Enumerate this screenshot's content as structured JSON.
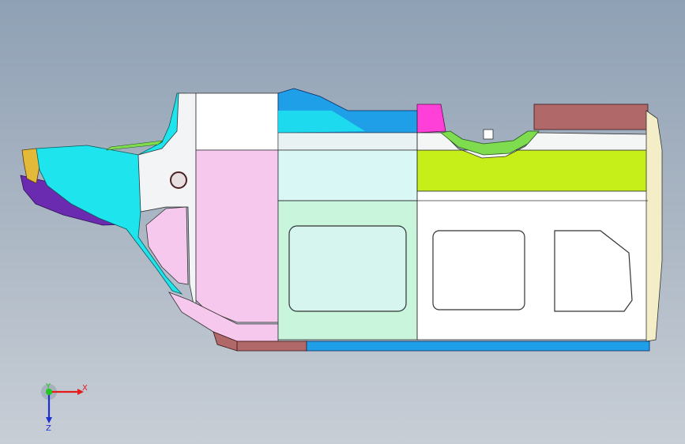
{
  "viewport": {
    "background_top": "#8fa1b5",
    "background_bottom": "#c8ced6"
  },
  "model": {
    "icon": "vehicle-body-side-icon",
    "colors": {
      "cyan": "#1ee4ee",
      "light_cyan": "#d8f7f5",
      "blue": "#1f9fe8",
      "lime": "#c6ef1a",
      "pink": "#f7c8ee",
      "magenta": "#ff40d8",
      "brown": "#b06868",
      "purple": "#6a2bb0",
      "green": "#7fdc4e",
      "mint": "#c8f5dc",
      "white": "#ffffff",
      "cream": "#f4eec8"
    }
  },
  "triad": {
    "x_label": "X",
    "y_label": "Y",
    "z_label": "Z",
    "x_color": "#e41c1c",
    "y_color": "#1ec81e",
    "z_color": "#2030d0"
  }
}
